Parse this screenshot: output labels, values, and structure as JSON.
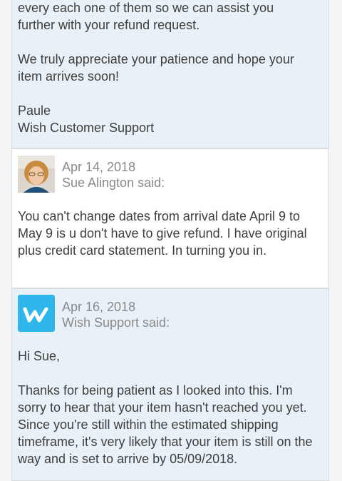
{
  "messages": [
    {
      "author_type": "support",
      "paragraphs": [
        "every each one of them so we can assist you further with your refund request.",
        "We truly appreciate your patience and hope your item arrives soon!"
      ],
      "signature_name": "Paule",
      "signature_team": "Wish Customer Support"
    },
    {
      "author_type": "customer",
      "date": "Apr 14, 2018",
      "author_line": "Sue Alington said:",
      "avatar_icon": "user-photo-avatar",
      "body": "You can't change dates from arrival date April 9 to May 9 is u don't have to give refund. I have original plus credit card statement. In turning you in."
    },
    {
      "author_type": "support",
      "date": "Apr 16, 2018",
      "author_line": "Wish Support said:",
      "avatar_icon": "wish-logo-icon",
      "greeting": "Hi Sue,",
      "body": "Thanks for being patient as I looked into this. I'm sorry to hear that your item hasn't reached you yet. Since you're still within the estimated shipping timeframe, it's very likely that your item is still on the way and is set to arrive by 05/09/2018."
    }
  ],
  "colors": {
    "support_bg": "#e8f1f7",
    "customer_bg": "#ffffff",
    "wish_brand": "#2fb7ec"
  }
}
